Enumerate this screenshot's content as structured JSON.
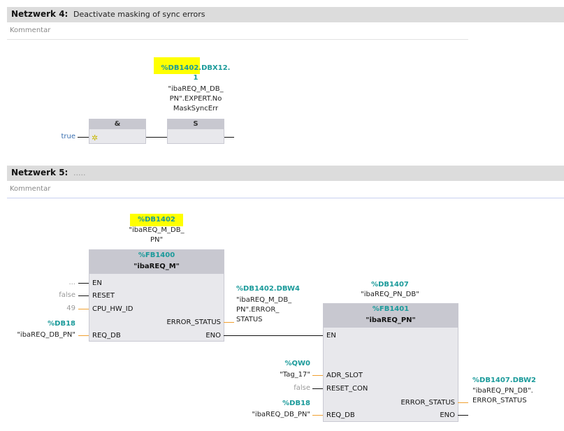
{
  "network4": {
    "title": "Netzwerk 4:",
    "description": "Deactivate masking of sync errors",
    "comment": "Kommentar",
    "operand_addr": "%DB1402.DBX12.",
    "operand_addr2": "1",
    "operand_sym1": "\"ibaREQ_M_DB_",
    "operand_sym2": "PN\".EXPERT.No",
    "operand_sym3": "MaskSyncErr",
    "and_label": "&",
    "set_label": "S",
    "input_value": "true"
  },
  "network5": {
    "title": "Netzwerk 5:",
    "description": ".....",
    "comment": "Kommentar",
    "fb1": {
      "instance_addr": "%DB1402",
      "instance_sym1": "\"ibaREQ_M_DB_",
      "instance_sym2": "PN\"",
      "fb_addr": "%FB1400",
      "fb_name": "\"ibaREQ_M\"",
      "pins": {
        "en": "EN",
        "reset": "RESET",
        "cpu": "CPU_HW_ID",
        "req_db": "REQ_DB",
        "error_status": "ERROR_STATUS",
        "eno": "ENO"
      },
      "values": {
        "en": "...",
        "reset": "false",
        "cpu": "49",
        "req_addr": "%DB18",
        "req_sym": "\"ibaREQ_DB_PN\""
      },
      "err_out_addr": "%DB1402.DBW4",
      "err_out_sym1": "\"ibaREQ_M_DB_",
      "err_out_sym2": "PN\".ERROR_",
      "err_out_sym3": "STATUS"
    },
    "fb2": {
      "instance_addr": "%DB1407",
      "instance_sym": "\"ibaREQ_PN_DB\"",
      "fb_addr": "%FB1401",
      "fb_name": "\"ibaREQ_PN\"",
      "pins": {
        "en": "EN",
        "adr_slot": "ADR_SLOT",
        "reset_con": "RESET_CON",
        "req_db": "REQ_DB",
        "error_status": "ERROR_STATUS",
        "eno": "ENO"
      },
      "values": {
        "adr_addr": "%QW0",
        "adr_sym": "\"Tag_17\"",
        "reset_con": "false",
        "req_addr": "%DB18",
        "req_sym": "\"ibaREQ_DB_PN\""
      },
      "err_out_addr": "%DB1407.DBW2",
      "err_out_sym1": "\"ibaREQ_PN_DB\".",
      "err_out_sym2": "ERROR_STATUS"
    }
  }
}
